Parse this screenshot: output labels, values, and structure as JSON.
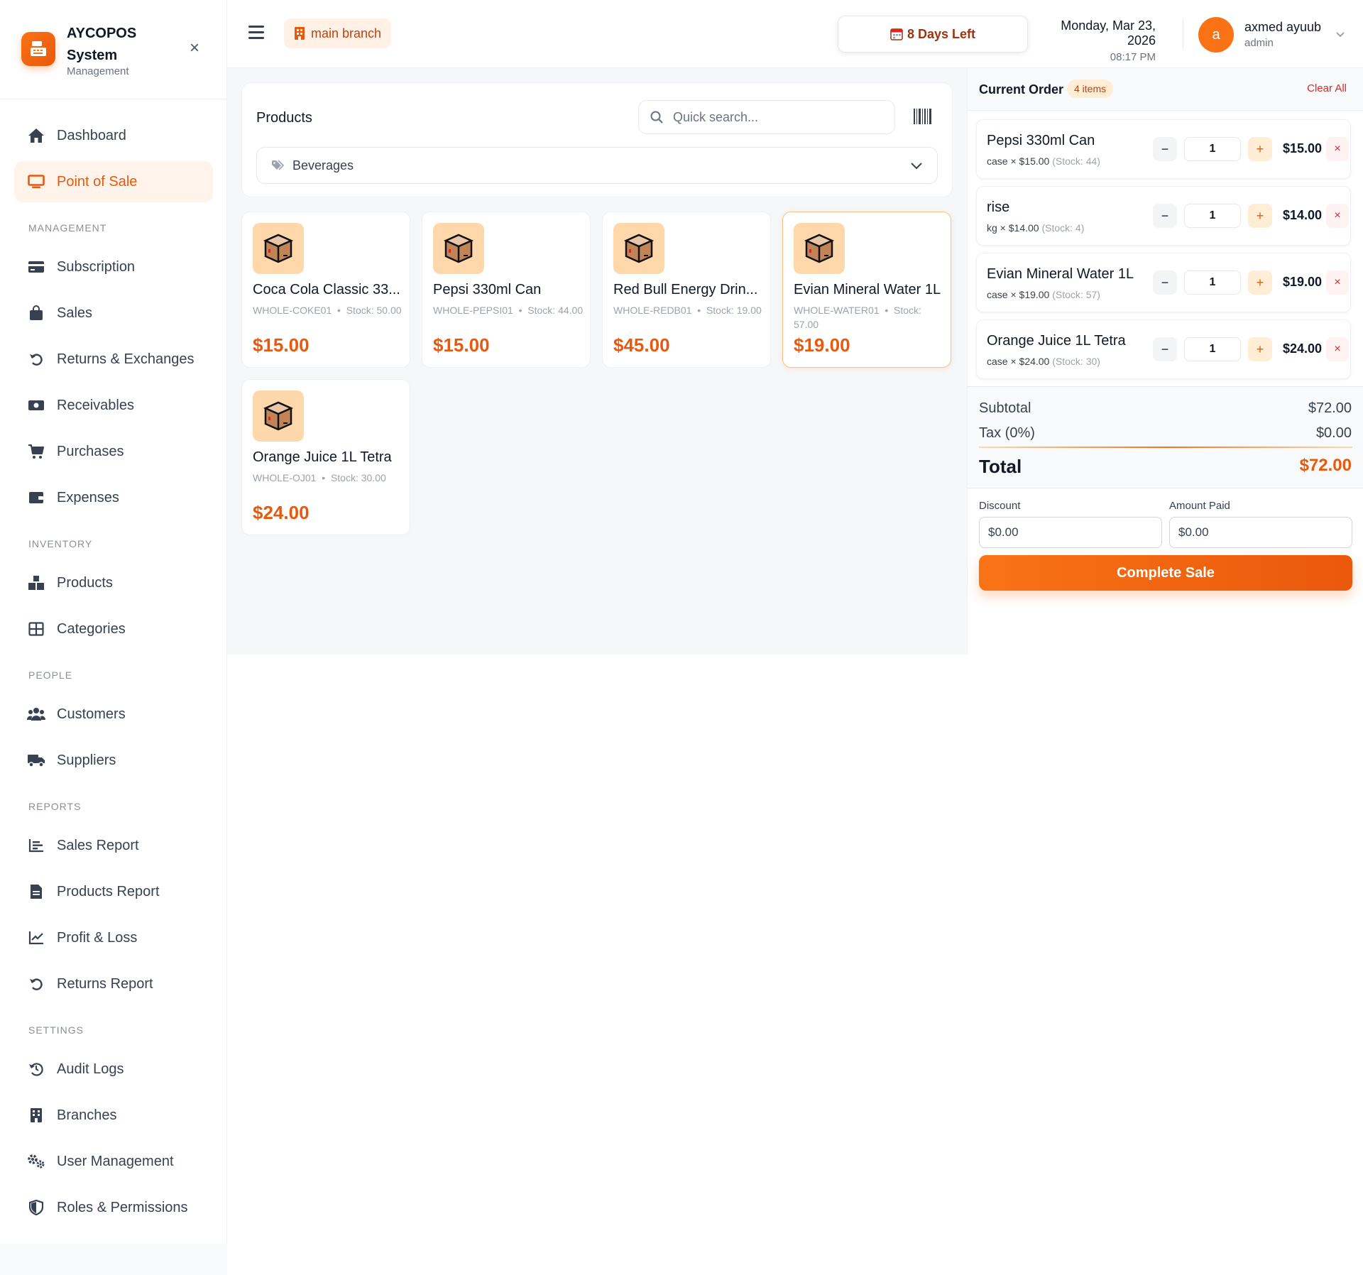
{
  "brand": {
    "name": "AYCOPOS System",
    "subtitle": "Management",
    "logo_icon": "cash-register-icon",
    "accent_color": "#f97316"
  },
  "sidebar": {
    "items": [
      {
        "label": "Dashboard",
        "icon": "home-icon",
        "active": false
      },
      {
        "label": "Point of Sale",
        "icon": "monitor-icon",
        "active": true
      },
      {
        "label": "Subscription",
        "icon": "credit-card-icon",
        "active": false
      },
      {
        "label": "Sales",
        "icon": "shopping-bag-icon",
        "active": false
      },
      {
        "label": "Returns & Exchanges",
        "icon": "undo-icon",
        "active": false
      },
      {
        "label": "Receivables",
        "icon": "money-icon",
        "active": false
      },
      {
        "label": "Purchases",
        "icon": "cart-icon",
        "active": false
      },
      {
        "label": "Expenses",
        "icon": "wallet-icon",
        "active": false
      },
      {
        "label": "Products",
        "icon": "boxes-icon",
        "active": false
      },
      {
        "label": "Categories",
        "icon": "grid-icon",
        "active": false
      },
      {
        "label": "Customers",
        "icon": "users-icon",
        "active": false
      },
      {
        "label": "Suppliers",
        "icon": "truck-icon",
        "active": false
      },
      {
        "label": "Sales Report",
        "icon": "bar-chart-icon",
        "active": false
      },
      {
        "label": "Products Report",
        "icon": "file-icon",
        "active": false
      },
      {
        "label": "Profit & Loss",
        "icon": "line-chart-icon",
        "active": false
      },
      {
        "label": "Returns Report",
        "icon": "undo-icon",
        "active": false
      },
      {
        "label": "Audit Logs",
        "icon": "history-icon",
        "active": false
      },
      {
        "label": "Branches",
        "icon": "building-icon",
        "active": false
      },
      {
        "label": "User Management",
        "icon": "cogs-icon",
        "active": false
      },
      {
        "label": "Roles & Permissions",
        "icon": "shield-icon",
        "active": false
      }
    ],
    "sections": [
      "MANAGEMENT",
      "INVENTORY",
      "PEOPLE",
      "REPORTS",
      "SETTINGS"
    ]
  },
  "header": {
    "branch": "main branch",
    "subscription": "8 Days Left",
    "date": "Monday, Mar 23, 2026",
    "time": "08:17 PM",
    "user": {
      "initial": "a",
      "name": "axmed ayuub",
      "role": "admin"
    }
  },
  "products": {
    "title": "Products",
    "search_placeholder": "Quick search...",
    "category": "Beverages",
    "items": [
      {
        "name": "Coca Cola Classic 33...",
        "sku": "WHOLE-COKE01",
        "stock_label": "Stock:",
        "stock": "50.00",
        "price": "$15.00",
        "selected": false
      },
      {
        "name": "Pepsi 330ml Can",
        "sku": "WHOLE-PEPSI01",
        "stock_label": "Stock:",
        "stock": "44.00",
        "price": "$15.00",
        "selected": false
      },
      {
        "name": "Red Bull Energy Drin...",
        "sku": "WHOLE-REDB01",
        "stock_label": "Stock:",
        "stock": "19.00",
        "price": "$45.00",
        "selected": false
      },
      {
        "name": "Evian Mineral Water 1L",
        "sku": "WHOLE-WATER01",
        "stock_label": "Stock:",
        "stock": "57.00",
        "price": "$19.00",
        "selected": true
      },
      {
        "name": "Orange Juice 1L Tetra",
        "sku": "WHOLE-OJ01",
        "stock_label": "Stock:",
        "stock": "30.00",
        "price": "$24.00",
        "selected": false
      }
    ]
  },
  "order": {
    "title": "Current Order",
    "count_badge": "4 items",
    "clear_label": "Clear All",
    "items": [
      {
        "name": "Pepsi 330ml Can",
        "unit": "case × $15.00",
        "stock": "(Stock: 44)",
        "qty": "1",
        "total": "$15.00"
      },
      {
        "name": "rise",
        "unit": "kg × $14.00",
        "stock": "(Stock: 4)",
        "qty": "1",
        "total": "$14.00"
      },
      {
        "name": "Evian Mineral Water 1L",
        "unit": "case × $19.00",
        "stock": "(Stock: 57)",
        "qty": "1",
        "total": "$19.00"
      },
      {
        "name": "Orange Juice 1L Tetra",
        "unit": "case × $24.00",
        "stock": "(Stock: 30)",
        "qty": "1",
        "total": "$24.00"
      }
    ],
    "subtotal_label": "Subtotal",
    "subtotal": "$72.00",
    "tax_label": "Tax (0%)",
    "tax": "$0.00",
    "total_label": "Total",
    "total": "$72.00",
    "discount_label": "Discount",
    "discount_placeholder": "$0.00",
    "paid_label": "Amount Paid",
    "paid_placeholder": "$0.00",
    "complete_label": "Complete Sale"
  }
}
